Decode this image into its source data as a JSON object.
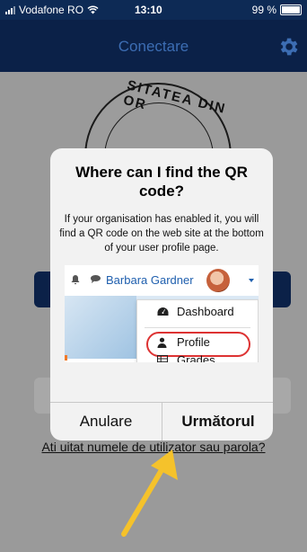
{
  "status_bar": {
    "carrier": "Vodafone RO",
    "time": "13:10",
    "battery": "99 %"
  },
  "app_bar": {
    "title": "Conectare",
    "settings_icon": "gear-icon"
  },
  "background": {
    "logo_text": "SITATEA DIN OR",
    "forgot_link": "Ati uitat numele de utilizator sau parola?"
  },
  "dialog": {
    "title": "Where can I find the QR code?",
    "message": "If your organisation has enabled it, you will find a QR code on the web site at the bottom of your user profile page.",
    "example": {
      "user_name": "Barbara Gardner",
      "menu_items": [
        {
          "label": "Dashboard",
          "icon": "dashboard-icon"
        },
        {
          "label": "Profile",
          "icon": "user-icon"
        },
        {
          "label": "Grades",
          "icon": "grid-icon"
        }
      ]
    },
    "cancel_label": "Anulare",
    "next_label": "Următorul"
  },
  "colors": {
    "header": "#0b2148",
    "highlight_circle": "#dd3333",
    "arrow": "#f5c22b",
    "link_blue": "#1f5fae"
  }
}
